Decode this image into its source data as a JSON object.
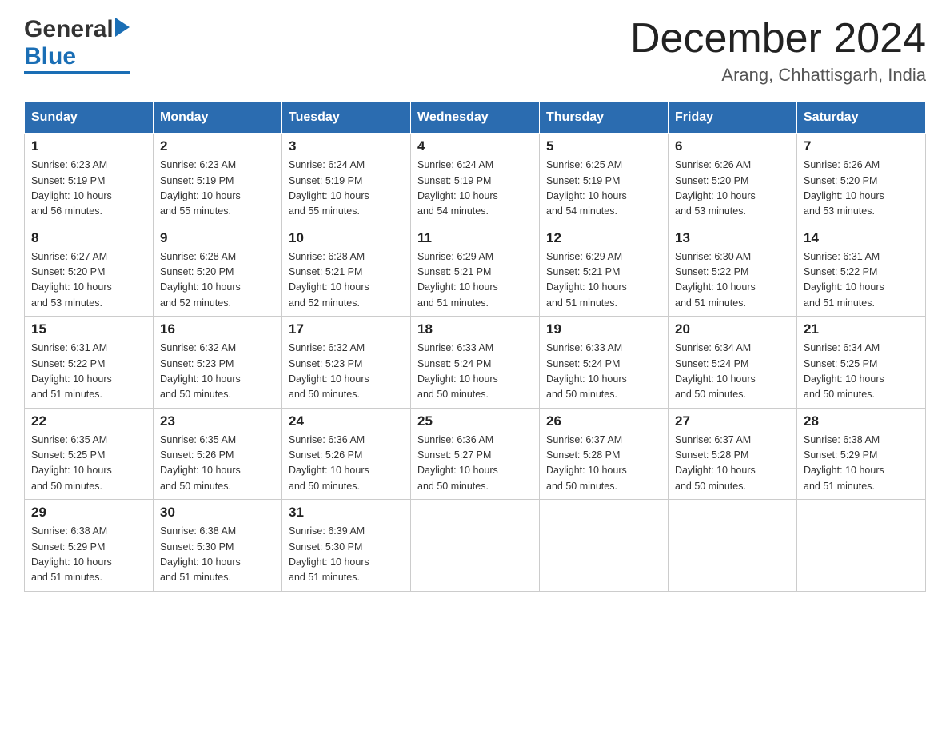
{
  "header": {
    "logo_general": "General",
    "logo_blue": "Blue",
    "month_year": "December 2024",
    "location": "Arang, Chhattisgarh, India"
  },
  "days_of_week": [
    "Sunday",
    "Monday",
    "Tuesday",
    "Wednesday",
    "Thursday",
    "Friday",
    "Saturday"
  ],
  "weeks": [
    [
      {
        "day": "1",
        "sunrise": "6:23 AM",
        "sunset": "5:19 PM",
        "daylight": "10 hours and 56 minutes."
      },
      {
        "day": "2",
        "sunrise": "6:23 AM",
        "sunset": "5:19 PM",
        "daylight": "10 hours and 55 minutes."
      },
      {
        "day": "3",
        "sunrise": "6:24 AM",
        "sunset": "5:19 PM",
        "daylight": "10 hours and 55 minutes."
      },
      {
        "day": "4",
        "sunrise": "6:24 AM",
        "sunset": "5:19 PM",
        "daylight": "10 hours and 54 minutes."
      },
      {
        "day": "5",
        "sunrise": "6:25 AM",
        "sunset": "5:19 PM",
        "daylight": "10 hours and 54 minutes."
      },
      {
        "day": "6",
        "sunrise": "6:26 AM",
        "sunset": "5:20 PM",
        "daylight": "10 hours and 53 minutes."
      },
      {
        "day": "7",
        "sunrise": "6:26 AM",
        "sunset": "5:20 PM",
        "daylight": "10 hours and 53 minutes."
      }
    ],
    [
      {
        "day": "8",
        "sunrise": "6:27 AM",
        "sunset": "5:20 PM",
        "daylight": "10 hours and 53 minutes."
      },
      {
        "day": "9",
        "sunrise": "6:28 AM",
        "sunset": "5:20 PM",
        "daylight": "10 hours and 52 minutes."
      },
      {
        "day": "10",
        "sunrise": "6:28 AM",
        "sunset": "5:21 PM",
        "daylight": "10 hours and 52 minutes."
      },
      {
        "day": "11",
        "sunrise": "6:29 AM",
        "sunset": "5:21 PM",
        "daylight": "10 hours and 51 minutes."
      },
      {
        "day": "12",
        "sunrise": "6:29 AM",
        "sunset": "5:21 PM",
        "daylight": "10 hours and 51 minutes."
      },
      {
        "day": "13",
        "sunrise": "6:30 AM",
        "sunset": "5:22 PM",
        "daylight": "10 hours and 51 minutes."
      },
      {
        "day": "14",
        "sunrise": "6:31 AM",
        "sunset": "5:22 PM",
        "daylight": "10 hours and 51 minutes."
      }
    ],
    [
      {
        "day": "15",
        "sunrise": "6:31 AM",
        "sunset": "5:22 PM",
        "daylight": "10 hours and 51 minutes."
      },
      {
        "day": "16",
        "sunrise": "6:32 AM",
        "sunset": "5:23 PM",
        "daylight": "10 hours and 50 minutes."
      },
      {
        "day": "17",
        "sunrise": "6:32 AM",
        "sunset": "5:23 PM",
        "daylight": "10 hours and 50 minutes."
      },
      {
        "day": "18",
        "sunrise": "6:33 AM",
        "sunset": "5:24 PM",
        "daylight": "10 hours and 50 minutes."
      },
      {
        "day": "19",
        "sunrise": "6:33 AM",
        "sunset": "5:24 PM",
        "daylight": "10 hours and 50 minutes."
      },
      {
        "day": "20",
        "sunrise": "6:34 AM",
        "sunset": "5:24 PM",
        "daylight": "10 hours and 50 minutes."
      },
      {
        "day": "21",
        "sunrise": "6:34 AM",
        "sunset": "5:25 PM",
        "daylight": "10 hours and 50 minutes."
      }
    ],
    [
      {
        "day": "22",
        "sunrise": "6:35 AM",
        "sunset": "5:25 PM",
        "daylight": "10 hours and 50 minutes."
      },
      {
        "day": "23",
        "sunrise": "6:35 AM",
        "sunset": "5:26 PM",
        "daylight": "10 hours and 50 minutes."
      },
      {
        "day": "24",
        "sunrise": "6:36 AM",
        "sunset": "5:26 PM",
        "daylight": "10 hours and 50 minutes."
      },
      {
        "day": "25",
        "sunrise": "6:36 AM",
        "sunset": "5:27 PM",
        "daylight": "10 hours and 50 minutes."
      },
      {
        "day": "26",
        "sunrise": "6:37 AM",
        "sunset": "5:28 PM",
        "daylight": "10 hours and 50 minutes."
      },
      {
        "day": "27",
        "sunrise": "6:37 AM",
        "sunset": "5:28 PM",
        "daylight": "10 hours and 50 minutes."
      },
      {
        "day": "28",
        "sunrise": "6:38 AM",
        "sunset": "5:29 PM",
        "daylight": "10 hours and 51 minutes."
      }
    ],
    [
      {
        "day": "29",
        "sunrise": "6:38 AM",
        "sunset": "5:29 PM",
        "daylight": "10 hours and 51 minutes."
      },
      {
        "day": "30",
        "sunrise": "6:38 AM",
        "sunset": "5:30 PM",
        "daylight": "10 hours and 51 minutes."
      },
      {
        "day": "31",
        "sunrise": "6:39 AM",
        "sunset": "5:30 PM",
        "daylight": "10 hours and 51 minutes."
      },
      null,
      null,
      null,
      null
    ]
  ],
  "labels": {
    "sunrise_prefix": "Sunrise: ",
    "sunset_prefix": "Sunset: ",
    "daylight_prefix": "Daylight: "
  }
}
